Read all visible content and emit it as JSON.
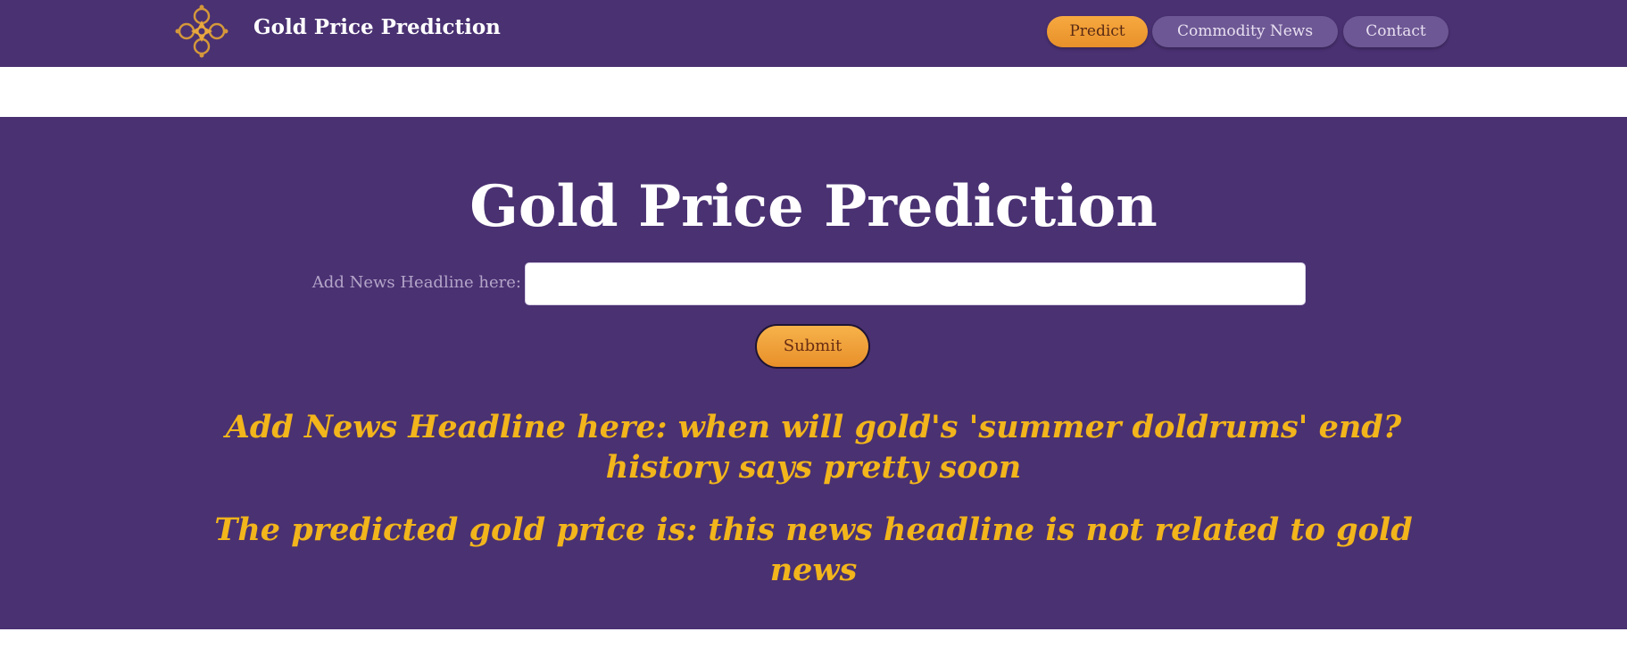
{
  "header": {
    "brand_title": "Gold Price Prediction",
    "logo_icon": "gold-ornament-logo-icon",
    "nav": [
      {
        "label": "Predict",
        "active": true
      },
      {
        "label": "Commodity News",
        "active": false
      },
      {
        "label": "Contact",
        "active": false
      }
    ]
  },
  "main": {
    "title": "Gold Price Prediction",
    "form": {
      "label": "Add News Headline here:",
      "input_value": "",
      "input_placeholder": "",
      "submit_label": "Submit"
    },
    "result": {
      "headline_text": "Add News Headline here: when will gold's 'summer doldrums' end? history says pretty soon",
      "prediction_text": "The predicted gold price is: this news headline is not related to gold news"
    }
  },
  "colors": {
    "brand_purple": "#4a3172",
    "accent_orange": "#f2a33a",
    "result_gold": "#f2b51b",
    "nav_inactive": "#6d5794"
  }
}
